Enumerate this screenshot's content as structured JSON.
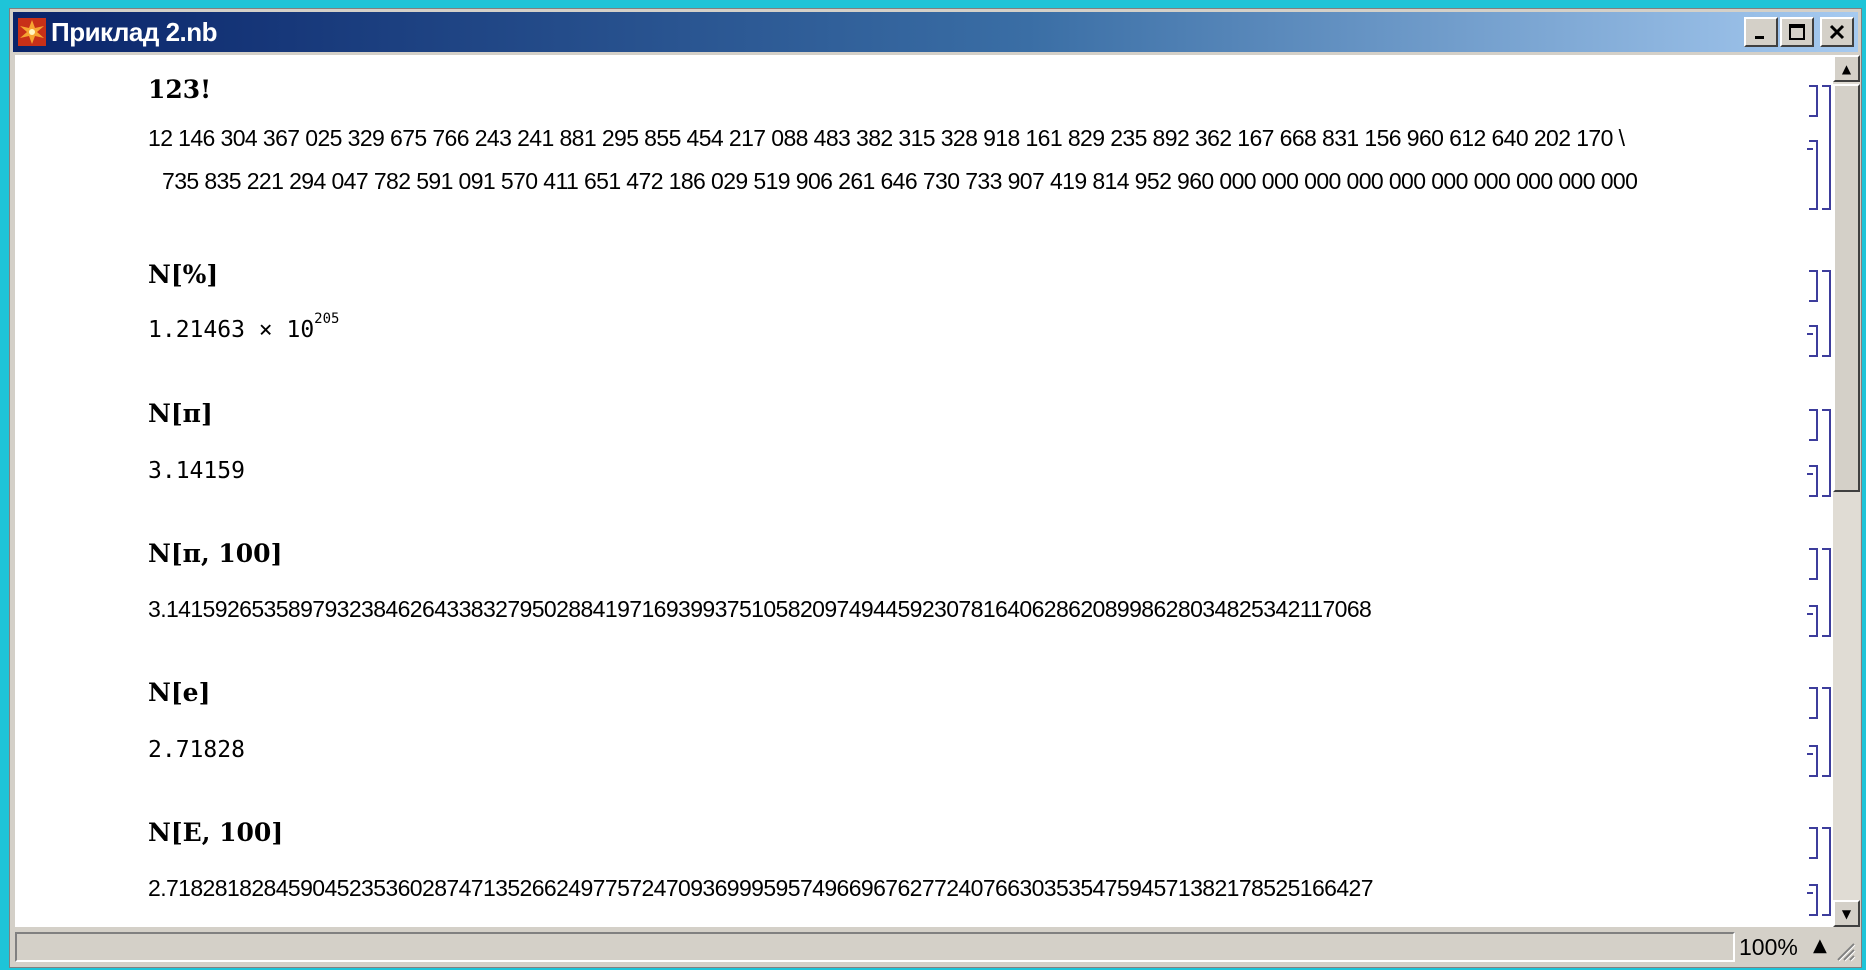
{
  "window": {
    "title": "Приклад 2.nb",
    "icon": "mathematica-star-icon",
    "buttons": {
      "minimize": "_",
      "maximize": "□",
      "close": "×"
    }
  },
  "cells": [
    {
      "input": "123!",
      "output_lines": [
        "12 146 304 367 025 329 675 766 243 241 881 295 855 454 217 088 483 382 315 328 918 161 829 235 892 362 167 668 831 156 960 612 640 202 170 \\",
        "735 835 221 294 047 782 591 091 570 411 651 472 186 029 519 906 261 646 730 733 907 419 814 952 960 000 000 000 000 000 000 000 000 000 000"
      ]
    },
    {
      "input": "N[%]",
      "output_mantissa": "1.21463 × 10",
      "output_exponent": "205"
    },
    {
      "input": "N[π]",
      "output": "3.14159"
    },
    {
      "input": "N[π, 100]",
      "output": "3.141592653589793238462643383279502884197169399375105820974944592307816406286208998628034825342117068"
    },
    {
      "input": "N[e]",
      "output": "2.71828"
    },
    {
      "input": "N[E, 100]",
      "output": "2.718281828459045235360287471352662497757247093699959574966967627724076630353547594571382178525166427"
    }
  ],
  "status": {
    "zoom": "100%",
    "zoom_arrow": "▲"
  },
  "scrollbar": {
    "up": "▲",
    "down": "▼"
  },
  "colors": {
    "title_start": "#0a246a",
    "title_end": "#a6caf0",
    "bracket": "#3d3d9c",
    "desktop": "#1ec4d8"
  }
}
